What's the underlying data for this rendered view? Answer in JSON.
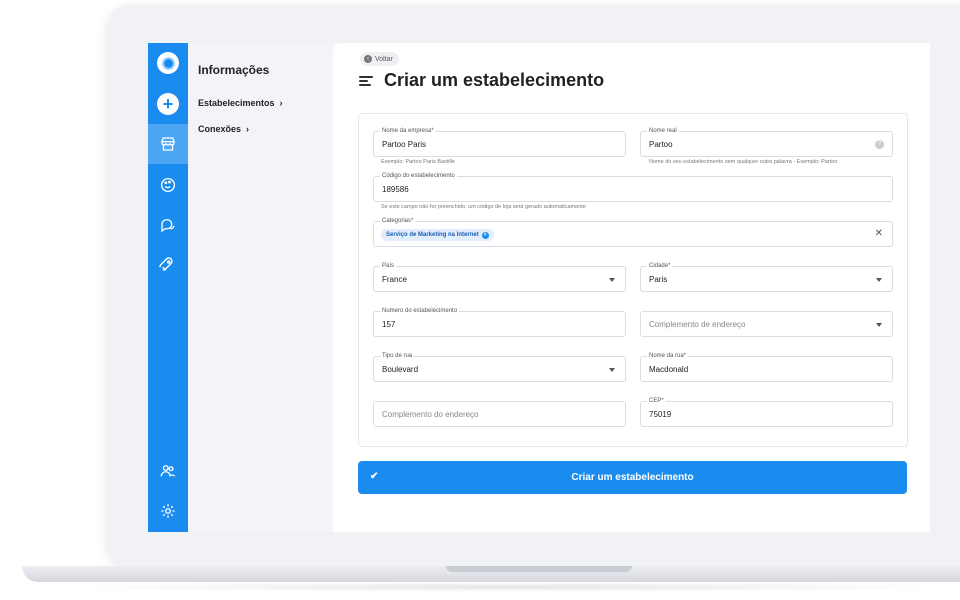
{
  "subnav": {
    "title": "Informações",
    "items": [
      {
        "label": "Estabelecimentos",
        "chevron": "›"
      },
      {
        "label": "Conexões",
        "chevron": "›"
      }
    ]
  },
  "header": {
    "back_label": "Voltar",
    "title": "Criar um estabelecimento"
  },
  "form": {
    "company_name": {
      "label": "Nome da empresa*",
      "value": "Partoo Paris",
      "hint": "Exemplo: Partoo Paris Bastille"
    },
    "real_name": {
      "label": "Nome real",
      "value": "Partoo",
      "hint": "Nome do seu estabelecimento sem qualquer outra palavra - Exemplo: Partoo"
    },
    "store_code": {
      "label": "Código do estabelecimento",
      "value": "189586",
      "hint": "Se este campo não for preenchido, um código de loja será gerado automaticamente"
    },
    "categories": {
      "label": "Categorias*",
      "chip": "Serviço de Marketing na Internet"
    },
    "country": {
      "label": "País",
      "value": "France"
    },
    "city": {
      "label": "Cidade*",
      "value": "Paris"
    },
    "street_number": {
      "label": "Numero do estabelecimento",
      "value": "157"
    },
    "address_complement_select": {
      "placeholder": "Complemento de endereço"
    },
    "street_type": {
      "label": "Tipo de rua",
      "value": "Boulevard"
    },
    "street_name": {
      "label": "Nome da rua*",
      "value": "Macdonald"
    },
    "address_complement_input": {
      "placeholder": "Complemento do endereço"
    },
    "zipcode": {
      "label": "CEP*",
      "value": "75019"
    }
  },
  "submit_label": "Criar um estabelecimento",
  "colors": {
    "accent": "#1a8cf0",
    "chip_bg": "#e2eefc"
  },
  "icons": [
    "logo-icon",
    "plus-icon",
    "store-icon",
    "palette-icon",
    "chat-icon",
    "rocket-icon",
    "users-icon",
    "gear-icon",
    "menu-icon",
    "back-arrow-icon",
    "help-icon",
    "close-icon",
    "check-icon"
  ]
}
